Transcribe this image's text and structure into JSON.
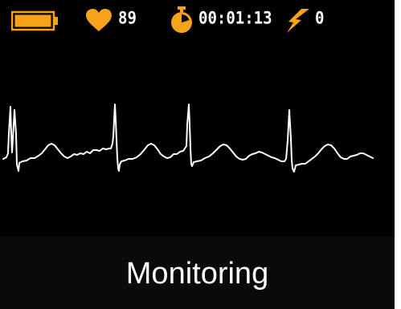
{
  "status_bar": {
    "battery": {
      "icon": "battery-full-icon",
      "level": 1.0,
      "color": "#f7a21b"
    },
    "heart_rate": {
      "icon": "heart-icon",
      "value": "89",
      "color": "#f7a21b"
    },
    "timer": {
      "icon": "stopwatch-icon",
      "value": "00:01:13",
      "color": "#f7a21b"
    },
    "shocks": {
      "icon": "lightning-bolt-icon",
      "value": "0",
      "color": "#f7a21b"
    }
  },
  "ecg": {
    "trace_color": "#ffffff",
    "background": "#000000",
    "beats_visible": 4
  },
  "footer": {
    "mode": "Monitoring"
  }
}
